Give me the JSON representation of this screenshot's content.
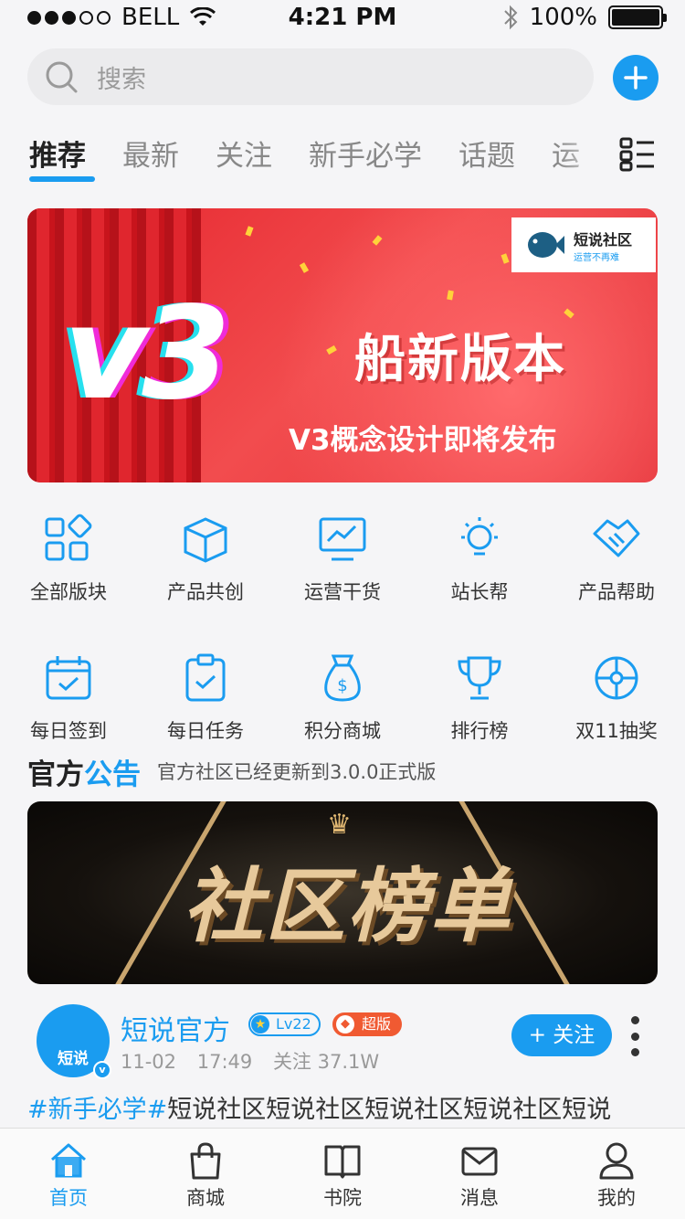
{
  "status_bar": {
    "carrier": "BELL",
    "time": "4:21 PM",
    "battery": "100%"
  },
  "search": {
    "placeholder": "搜索"
  },
  "tabs": [
    {
      "label": "推荐",
      "active": true
    },
    {
      "label": "最新"
    },
    {
      "label": "关注"
    },
    {
      "label": "新手必学"
    },
    {
      "label": "话题"
    },
    {
      "label": "运"
    }
  ],
  "banner": {
    "brand": "v3",
    "title": "船新版本",
    "subtitle": "V3概念设计即将发布",
    "logo_name": "短说社区",
    "logo_slogan": "运营不再难"
  },
  "grid": [
    {
      "label": "全部版块",
      "icon": "blocks-icon"
    },
    {
      "label": "产品共创",
      "icon": "cube-icon"
    },
    {
      "label": "运营干货",
      "icon": "monitor-chart-icon"
    },
    {
      "label": "站长帮",
      "icon": "bulb-icon"
    },
    {
      "label": "产品帮助",
      "icon": "handshake-icon"
    },
    {
      "label": "每日签到",
      "icon": "calendar-check-icon"
    },
    {
      "label": "每日任务",
      "icon": "clipboard-check-icon"
    },
    {
      "label": "积分商城",
      "icon": "money-bag-icon"
    },
    {
      "label": "排行榜",
      "icon": "trophy-icon"
    },
    {
      "label": "双11抽奖",
      "icon": "lottery-wheel-icon"
    }
  ],
  "announcement": {
    "title_a": "官方",
    "title_b": "公告",
    "text": "官方社区已经更新到3.0.0正式版"
  },
  "rank_banner": {
    "title": "社区榜单"
  },
  "post": {
    "avatar_text": "短说",
    "author": "短说官方",
    "level": "Lv22",
    "badge": "超版",
    "date": "11-02",
    "time": "17:49",
    "followers": "关注 37.1W",
    "follow_label": "+ 关注",
    "tag": "#新手必学#",
    "content": "短说社区短说社区短说社区短说社区短说"
  },
  "bottom_nav": [
    {
      "label": "首页",
      "active": true
    },
    {
      "label": "商城"
    },
    {
      "label": "书院"
    },
    {
      "label": "消息"
    },
    {
      "label": "我的"
    }
  ],
  "colors": {
    "accent": "#1a9cf0",
    "banner_red": "#e5252d",
    "badge_orange": "#f05a32"
  }
}
